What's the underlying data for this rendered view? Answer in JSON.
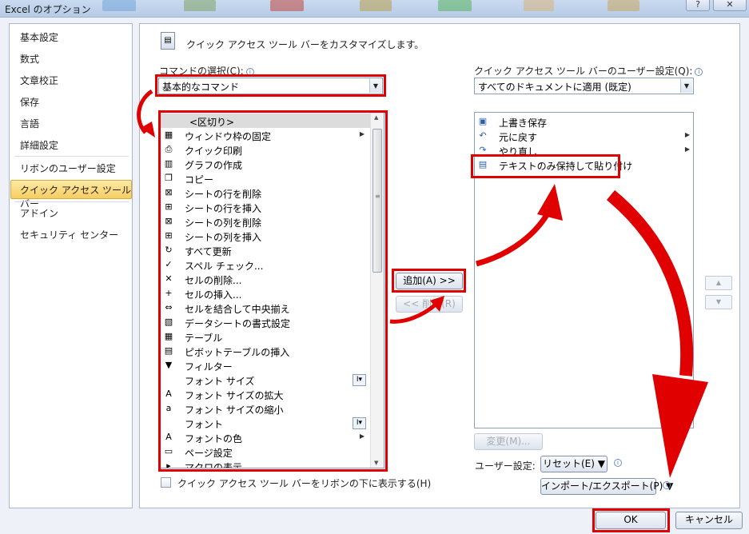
{
  "window": {
    "title": "Excel のオプション",
    "help_button": "?",
    "close_button": "✕"
  },
  "nav": {
    "items": [
      "基本設定",
      "数式",
      "文章校正",
      "保存",
      "言語",
      "詳細設定",
      "リボンのユーザー設定",
      "クイック アクセス ツール バー",
      "アドイン",
      "セキュリティ センター"
    ],
    "selected": "クイック アクセス ツール バー"
  },
  "header": {
    "description": "クイック アクセス ツール バーをカスタマイズします。"
  },
  "left": {
    "label": "コマンドの選択(C):",
    "combo_value": "基本的なコマンド",
    "commands": [
      {
        "label": "<区切り>",
        "icon": "separator"
      },
      {
        "label": "ウィンドウ枠の固定",
        "icon": "freeze-panes-icon",
        "submenu": true
      },
      {
        "label": "クイック印刷",
        "icon": "quick-print-icon"
      },
      {
        "label": "グラフの作成",
        "icon": "chart-icon"
      },
      {
        "label": "コピー",
        "icon": "copy-icon"
      },
      {
        "label": "シートの行を削除",
        "icon": "delete-row-icon"
      },
      {
        "label": "シートの行を挿入",
        "icon": "insert-row-icon"
      },
      {
        "label": "シートの列を削除",
        "icon": "delete-column-icon"
      },
      {
        "label": "シートの列を挿入",
        "icon": "insert-column-icon"
      },
      {
        "label": "すべて更新",
        "icon": "refresh-all-icon"
      },
      {
        "label": "スペル チェック...",
        "icon": "spell-check-icon"
      },
      {
        "label": "セルの削除...",
        "icon": "delete-cell-icon"
      },
      {
        "label": "セルの挿入...",
        "icon": "insert-cell-icon"
      },
      {
        "label": "セルを結合して中央揃え",
        "icon": "merge-center-icon"
      },
      {
        "label": "データシートの書式設定",
        "icon": "format-sheet-icon"
      },
      {
        "label": "テーブル",
        "icon": "table-icon"
      },
      {
        "label": "ピボットテーブルの挿入",
        "icon": "pivot-table-icon"
      },
      {
        "label": "フィルター",
        "icon": "filter-icon"
      },
      {
        "label": "フォント サイズ",
        "icon": "none",
        "box": "I▾"
      },
      {
        "label": "フォント サイズの拡大",
        "icon": "grow-font-icon"
      },
      {
        "label": "フォント サイズの縮小",
        "icon": "shrink-font-icon"
      },
      {
        "label": "フォント",
        "icon": "none",
        "box": "I▾"
      },
      {
        "label": "フォントの色",
        "icon": "font-color-icon",
        "submenu": true
      },
      {
        "label": "ページ設定",
        "icon": "page-setup-icon"
      },
      {
        "label": "マクロの表示",
        "icon": "macro-icon"
      }
    ],
    "show_below_ribbon": "クイック アクセス ツール バーをリボンの下に表示する(H)"
  },
  "middle": {
    "add_button": "追加(A) >>",
    "remove_button": "<< 削除(R)"
  },
  "right": {
    "label": "クイック アクセス ツール バーのユーザー設定(Q):",
    "combo_value": "すべてのドキュメントに適用 (既定)",
    "items": [
      {
        "label": "上書き保存",
        "icon": "save-icon"
      },
      {
        "label": "元に戻す",
        "icon": "undo-icon",
        "submenu": true
      },
      {
        "label": "やり直し",
        "icon": "redo-icon",
        "submenu": true
      },
      {
        "label": "テキストのみ保持して貼り付け",
        "icon": "paste-text-icon"
      }
    ],
    "modify_button": "変更(M)...",
    "user_settings_label": "ユーザー設定:",
    "reset_button": "リセット(E) ▼",
    "import_export_button": "インポート/エクスポート(P) ▼",
    "move_up": "▲",
    "move_down": "▼"
  },
  "footer": {
    "ok_button": "OK",
    "cancel_button": "キャンセル"
  },
  "colors": {
    "highlight": "#e00000",
    "nav_selected": "#f6cd60"
  }
}
